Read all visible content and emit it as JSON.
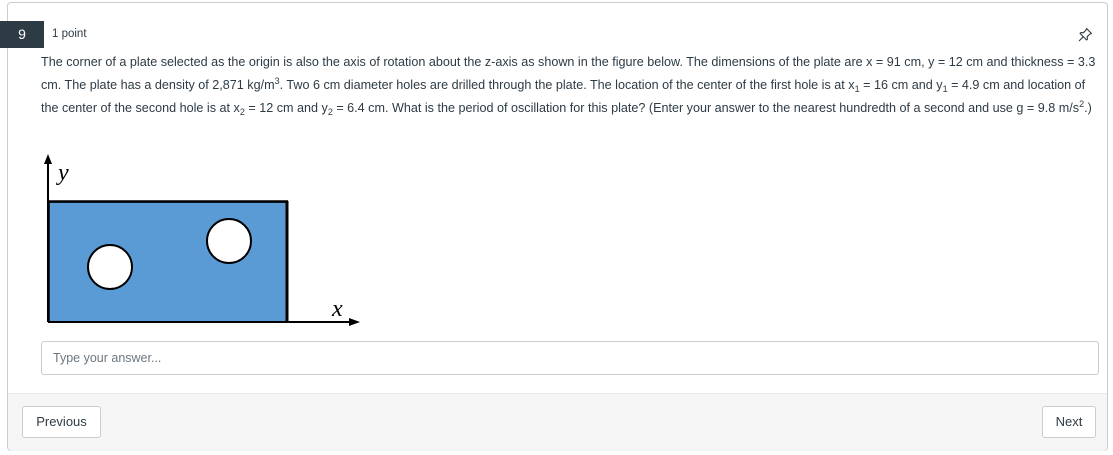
{
  "question": {
    "number": "9",
    "points": "1 point",
    "text": {
      "p1": "The corner of a plate selected as the origin is also the axis of rotation about the z-axis as shown in the figure below. The dimensions of the plate are x = 91 cm, y = 12 cm and thickness = 3.3 cm. The plate has a density of 2,871 kg/m",
      "sup1": "3",
      "p2": ". Two 6 cm diameter holes are drilled through the plate. The location of the center of the first hole is at x",
      "sub1": "1",
      "p3": " = 16 cm and y",
      "sub2": "1",
      "p4": " = 4.9 cm and location of the center of the second hole is at x",
      "sub3": "2",
      "p5": " = 12 cm and y",
      "sub4": "2",
      "p6": " = 6.4 cm.  What is the period of oscillation for this plate? (Enter your answer to the nearest hundredth of a second and use g = 9.8 m/s",
      "sup2": "2",
      "p7": ".)"
    }
  },
  "figure": {
    "y_label": "y",
    "x_label": "x",
    "plate_color": "#5b9bd5"
  },
  "answer": {
    "placeholder": "Type your answer..."
  },
  "nav": {
    "previous": "Previous",
    "next": "Next"
  },
  "icons": {
    "pin": "pin-icon"
  }
}
